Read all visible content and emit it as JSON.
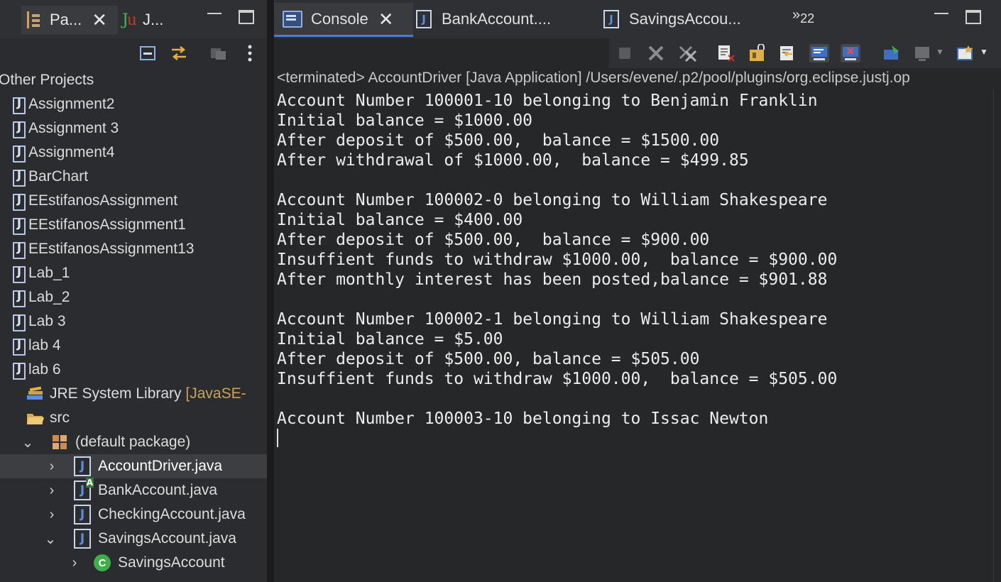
{
  "left_panel": {
    "tabs": [
      {
        "label": "Pa...",
        "icon": "package-explorer-icon"
      },
      {
        "label": "J...",
        "icon": "junit-icon",
        "icon_text": "Ju"
      }
    ],
    "tree": [
      {
        "label": "Other Projects",
        "type": "category"
      },
      {
        "label": "Assignment2",
        "type": "project"
      },
      {
        "label": "Assignment 3",
        "type": "project"
      },
      {
        "label": "Assignment4",
        "type": "project"
      },
      {
        "label": "BarChart",
        "type": "project"
      },
      {
        "label": "EEstifanosAssignment",
        "type": "project"
      },
      {
        "label": "EEstifanosAssignment1",
        "type": "project"
      },
      {
        "label": "EEstifanosAssignment13",
        "type": "project"
      },
      {
        "label": "Lab_1",
        "type": "project"
      },
      {
        "label": "Lab_2",
        "type": "project"
      },
      {
        "label": "Lab 3",
        "type": "project"
      },
      {
        "label": "lab 4",
        "type": "project"
      },
      {
        "label": "lab 6",
        "type": "project"
      },
      {
        "label": "JRE System Library",
        "suffix": "[JavaSE-",
        "type": "library"
      },
      {
        "label": "src",
        "type": "folder"
      },
      {
        "label": "(default package)",
        "type": "package",
        "expanded": true
      },
      {
        "label": "AccountDriver.java",
        "type": "java",
        "selected": true
      },
      {
        "label": "BankAccount.java",
        "type": "java-abstract"
      },
      {
        "label": "CheckingAccount.java",
        "type": "java"
      },
      {
        "label": "SavingsAccount.java",
        "type": "java",
        "expanded": true
      },
      {
        "label": "SavingsAccount",
        "type": "class",
        "icon_text": "C"
      }
    ]
  },
  "right_panel": {
    "tabs": [
      {
        "label": "Console",
        "icon": "console-icon",
        "active": true
      },
      {
        "label": "BankAccount....",
        "icon": "java-file-icon"
      },
      {
        "label": "SavingsAccou...",
        "icon": "java-file-icon"
      }
    ],
    "overflow": {
      "symbol": "»",
      "count": "22"
    },
    "status_line": "<terminated> AccountDriver [Java Application] /Users/evene/.p2/pool/plugins/org.eclipse.justj.op",
    "console_lines": [
      "Account Number 100001-10 belonging to Benjamin Franklin",
      "Initial balance = $1000.00",
      "After deposit of $500.00,  balance = $1500.00",
      "After withdrawal of $1000.00,  balance = $499.85",
      "",
      "Account Number 100002-0 belonging to William Shakespeare",
      "Initial balance = $400.00",
      "After deposit of $500.00,  balance = $900.00",
      "Insuffient funds to withdraw $1000.00,  balance = $900.00",
      "After monthly interest has been posted,balance = $901.88",
      "",
      "Account Number 100002-1 belonging to William Shakespeare",
      "Initial balance = $5.00",
      "After deposit of $500.00, balance = $505.00",
      "Insuffient funds to withdraw $1000.00,  balance = $505.00",
      "",
      "Account Number 100003-10 belonging to Issac Newton"
    ]
  },
  "colors": {
    "background": "#262729",
    "selection": "#3d3e42",
    "accent": "#4b7bd6",
    "class_icon": "#3fae4a"
  }
}
